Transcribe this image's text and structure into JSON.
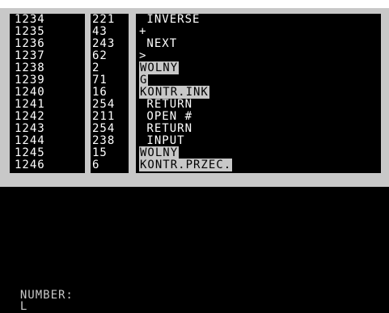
{
  "colors": {
    "screen_bg": "#000000",
    "frame": "#c8c8c8",
    "text": "#ffffff"
  },
  "rows": [
    {
      "addr": "1234",
      "val": "221",
      "instr": " INVERSE",
      "inverse": false
    },
    {
      "addr": "1235",
      "val": "43",
      "instr": "+",
      "inverse": false
    },
    {
      "addr": "1236",
      "val": "243",
      "instr": " NEXT",
      "inverse": false
    },
    {
      "addr": "1237",
      "val": "62",
      "instr": ">",
      "inverse": false
    },
    {
      "addr": "1238",
      "val": "2",
      "instr": "WOLNY",
      "inverse": true
    },
    {
      "addr": "1239",
      "val": "71",
      "instr": "G",
      "inverse": true
    },
    {
      "addr": "1240",
      "val": "16",
      "instr": "KONTR.INK",
      "inverse": true
    },
    {
      "addr": "1241",
      "val": "254",
      "instr": " RETURN",
      "inverse": false
    },
    {
      "addr": "1242",
      "val": "211",
      "instr": " OPEN #",
      "inverse": false
    },
    {
      "addr": "1243",
      "val": "254",
      "instr": " RETURN",
      "inverse": false
    },
    {
      "addr": "1244",
      "val": "238",
      "instr": " INPUT",
      "inverse": false
    },
    {
      "addr": "1245",
      "val": "15",
      "instr": "WOLNY",
      "inverse": true
    },
    {
      "addr": "1246",
      "val": "6",
      "instr": "KONTR.PRZEC.",
      "inverse": true
    }
  ],
  "status": {
    "label": "NUMBER:",
    "value": "L"
  }
}
